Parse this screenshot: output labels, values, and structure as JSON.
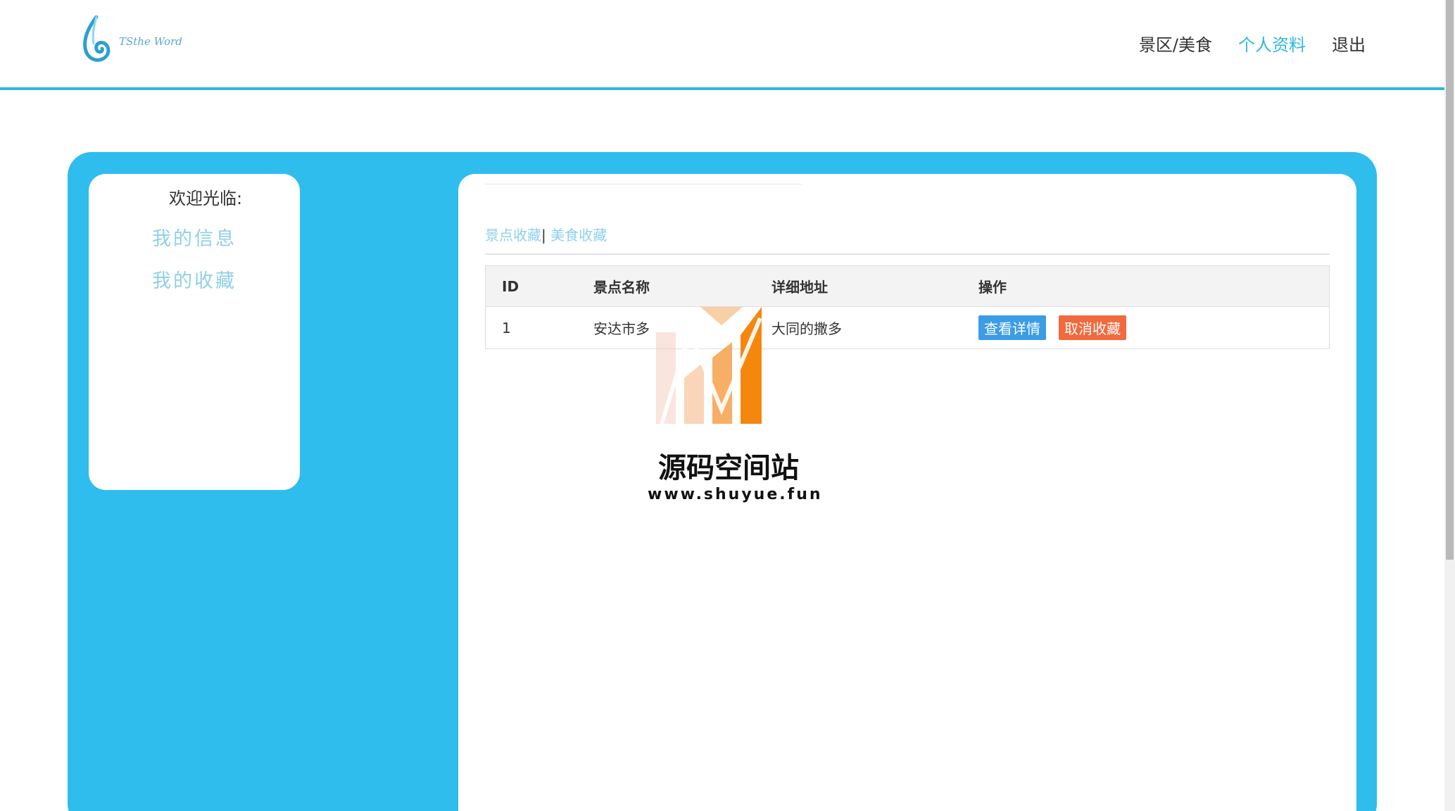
{
  "header": {
    "logo_text": "TSthe Word",
    "nav": [
      {
        "label": "景区/美食",
        "active": false
      },
      {
        "label": "个人资料",
        "active": true
      },
      {
        "label": "退出",
        "active": false
      }
    ]
  },
  "sidebar": {
    "welcome": "欢迎光临:",
    "links": [
      "我的信息",
      "我的收藏"
    ]
  },
  "content": {
    "tabs": [
      "景点收藏",
      "美食收藏"
    ],
    "tab_separator": "|",
    "table": {
      "headers": [
        "ID",
        "景点名称",
        "详细地址",
        "操作"
      ],
      "rows": [
        {
          "id": "1",
          "name": "安达市多",
          "address": "大同的撒多",
          "actions": [
            "查看详情",
            "取消收藏"
          ]
        }
      ]
    }
  },
  "watermark": {
    "title": "源码空间站",
    "url": "www.shuyue.fun"
  },
  "colors": {
    "accent": "#2ebded",
    "link_light": "#8fd0e8",
    "button_detail": "#3c9ce6",
    "button_cancel": "#f16a3e",
    "watermark_orange": "#f5870f"
  },
  "icons": [
    "logo-drop-icon",
    "watermark-logo-icon"
  ]
}
